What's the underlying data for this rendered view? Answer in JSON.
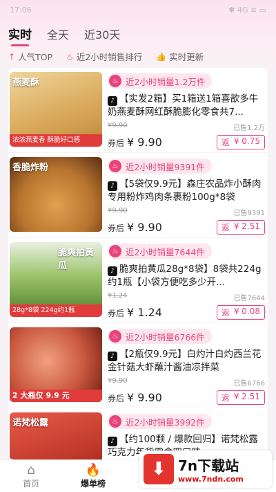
{
  "status_bar": {
    "time": "17:06",
    "right_icons": "✱ 4G ≋ ▭"
  },
  "tabs": [
    "实时",
    "全天",
    "近30天"
  ],
  "subtabs": [
    {
      "icon": "up-arrow-icon",
      "glyph": "↑",
      "label": "人气TOP"
    },
    {
      "icon": "fire-icon",
      "glyph": "♨",
      "label": "近2小时销售排行"
    },
    {
      "icon": "thumb-icon",
      "glyph": "👍",
      "label": "实时更新"
    }
  ],
  "products": [
    {
      "sales": "近2小时销量1.2万件",
      "title": "【实发2箱】买1箱送1箱喜歆多牛奶燕麦酥网红酥脆膨化零食共7...",
      "original_price": "¥9.90",
      "sold": "已售1.2万",
      "after_coupon_label": "券后",
      "price": "¥ 9.90",
      "rebate_label": "返",
      "rebate": "¥ 0.75",
      "thumb_text": "燕麦酥",
      "thumb_foot": "浓浓燕麦香 酥脆好口感",
      "thumb_color": "#d8a656"
    },
    {
      "sales": "近2小时销量9391件",
      "title": "【5袋仅9.9元】森庄农品炸小酥肉专用粉炸鸡肉条裹粉100g*8袋",
      "original_price": "¥9.90",
      "sold": "已售9391",
      "after_coupon_label": "券后",
      "price": "¥ 9.90",
      "rebate_label": "返",
      "rebate": "¥ 2.51",
      "thumb_text": "香脆炸粉",
      "thumb_foot": "",
      "thumb_color": "#b8742e"
    },
    {
      "sales": "近2小时销量7644件",
      "title": "脆爽拍黄瓜28g*8袋】8袋共224g约1瓶【小袋方便吃多少开...",
      "original_price": "¥1.24",
      "sold": "已售7644",
      "after_coupon_label": "券后",
      "price": "¥ 1.24",
      "rebate_label": "返",
      "rebate": "¥ 0.08",
      "thumb_text": "脆爽拍黄瓜",
      "thumb_foot": "28g*8袋 224g约1瓶",
      "thumb_color": "#6a9a3a"
    },
    {
      "sales": "近2小时销量6766件",
      "title": "【2瓶仅9.9元】白灼汁白灼西兰花金针菇大虾蘸汁酱油凉拌菜",
      "original_price": "¥9.90",
      "sold": "已售6766",
      "after_coupon_label": "券后",
      "price": "¥ 9.90",
      "rebate_label": "返",
      "rebate": "¥ 2.51",
      "thumb_text": "",
      "thumb_foot": "2 大瓶仅 9.9 元",
      "thumb_color": "#c9573e"
    },
    {
      "sales": "近2小时销量3992件",
      "title": "【约100颗 / 爆款回归】诺梵松露巧克力年货零食四口味...",
      "original_price": "",
      "sold": "",
      "after_coupon_label": "",
      "price": "",
      "rebate_label": "",
      "rebate": "",
      "thumb_text": "诺梵松露",
      "thumb_foot": "",
      "thumb_color": "#c0392b"
    }
  ],
  "bottom_nav": [
    {
      "label": "首页",
      "glyph": "⌂"
    },
    {
      "label": "爆单榜",
      "glyph": "🔥"
    }
  ],
  "watermark": {
    "logo": "⬇",
    "title": "7n下载站",
    "url": "www.7ndn.com"
  },
  "colors": {
    "accent": "#e9447a",
    "background": "#f6f2f5"
  }
}
